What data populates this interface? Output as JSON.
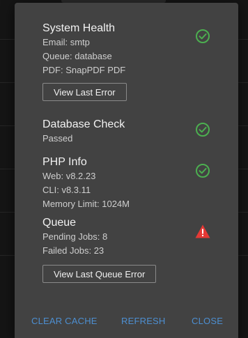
{
  "dialog": {
    "sections": [
      {
        "title": "System Health",
        "details": [
          "Email: smtp",
          "Queue: database",
          "PDF: SnapPDF PDF"
        ],
        "status": "ok",
        "status_icon": "check-circle-icon"
      },
      {
        "title": "Database Check",
        "details": [
          "Passed"
        ],
        "status": "ok",
        "status_icon": "check-circle-icon"
      },
      {
        "title": "PHP Info",
        "details": [
          "Web: v8.2.23",
          "CLI: v8.3.11",
          "Memory Limit: 1024M"
        ],
        "status": "ok",
        "status_icon": "check-circle-icon"
      },
      {
        "title": "Queue",
        "details": [
          "Pending Jobs: 8",
          "Failed Jobs: 23"
        ],
        "status": "warning",
        "status_icon": "warning-triangle-icon"
      }
    ],
    "view_last_error_label": "View Last Error",
    "view_last_queue_error_label": "View Last Queue Error",
    "footer": {
      "clear_cache_label": "CLEAR CACHE",
      "refresh_label": "REFRESH",
      "close_label": "CLOSE"
    }
  },
  "colors": {
    "dialog_bg": "#424242",
    "ok_green": "#4caf50",
    "warning_red": "#e53935",
    "accent_blue": "#4d8fd1"
  }
}
